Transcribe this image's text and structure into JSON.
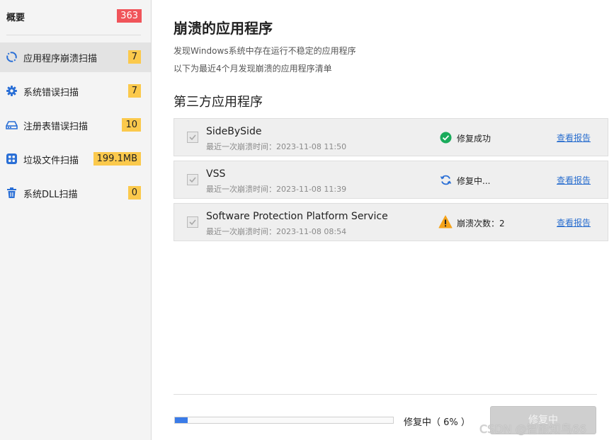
{
  "sidebar": {
    "title": "概要",
    "total_badge": "363",
    "items": [
      {
        "label": "应用程序崩溃扫描",
        "count": "7",
        "icon": "refresh-circle-icon",
        "active": true
      },
      {
        "label": "系统错误扫描",
        "count": "7",
        "icon": "gear-icon",
        "active": false
      },
      {
        "label": "注册表错误扫描",
        "count": "10",
        "icon": "drive-icon",
        "active": false
      },
      {
        "label": "垃圾文件扫描",
        "count": "199.1MB",
        "icon": "grid-apps-icon",
        "active": false
      },
      {
        "label": "系统DLL扫描",
        "count": "0",
        "icon": "trash-icon",
        "active": false
      }
    ]
  },
  "main": {
    "title": "崩溃的应用程序",
    "desc_line1": "发现Windows系统中存在运行不稳定的应用程序",
    "desc_line2": "以下为最近4个月发现崩溃的应用程序清单",
    "section_title": "第三方应用程序",
    "apps": [
      {
        "name": "SideBySide",
        "time": "最近一次崩溃时间：2023-11-08 11:50",
        "status": "修复成功",
        "status_icon": "check-circle-icon",
        "report": "查看报告"
      },
      {
        "name": "VSS",
        "time": "最近一次崩溃时间：2023-11-08 11:39",
        "status": "修复中...",
        "status_icon": "sync-icon",
        "report": "查看报告"
      },
      {
        "name": "Software Protection Platform Service",
        "time": "最近一次崩溃时间：2023-11-08 08:54",
        "status": "崩溃次数：2",
        "status_icon": "warning-icon",
        "report": "查看报告"
      }
    ]
  },
  "footer": {
    "progress_percent": 6,
    "progress_text": "修复中（ 6% ）",
    "repair_button": "修复中"
  },
  "watermark": "CSDN @智能知鸟66",
  "colors": {
    "accent": "#3a7be8",
    "total_badge": "#f0545a",
    "count_badge": "#fbc94c",
    "success": "#1aab5b",
    "warning": "#f5a31a",
    "link": "#2b6fcf"
  }
}
